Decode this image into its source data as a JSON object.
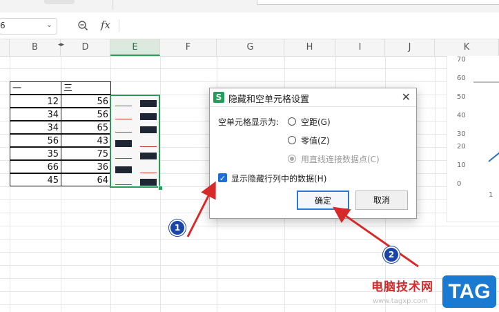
{
  "formula_bar": {
    "name_box_value": "6",
    "fx_label": "fx"
  },
  "columns": [
    "B",
    "D",
    "E",
    "F",
    "G",
    "H",
    "I",
    "J",
    "K"
  ],
  "header_row": {
    "col_b": "一",
    "col_d": "三"
  },
  "rows": [
    {
      "b": "12",
      "d": "56"
    },
    {
      "b": "34",
      "d": "56"
    },
    {
      "b": "34",
      "d": "65"
    },
    {
      "b": "56",
      "d": "43"
    },
    {
      "b": "35",
      "d": "75"
    },
    {
      "b": "66",
      "d": "36"
    },
    {
      "b": "45",
      "d": "64"
    }
  ],
  "chart": {
    "y_ticks": [
      "70",
      "60",
      "50",
      "40",
      "30",
      "20",
      "10",
      "0"
    ],
    "x_tick": "1"
  },
  "dialog": {
    "title": "隐藏和空单元格设置",
    "empty_cell_label": "空单元格显示为:",
    "option_gap": "空距(G)",
    "option_zero": "零值(Z)",
    "option_connect": "用直线连接数据点(C)",
    "show_hidden_label": "显示隐藏行列中的数据(H)",
    "ok": "确定",
    "cancel": "取消"
  },
  "annotations": {
    "badge1": "1",
    "badge2": "2"
  },
  "watermark": {
    "text": "电脑技术网",
    "url": "www.tagxp.com",
    "tag": "TAG"
  },
  "colors": {
    "accent_green": "#2b9a58",
    "dialog_ok_border": "#2b78d4",
    "arrow_red": "#d62a2a",
    "badge_blue": "#1946a8"
  }
}
